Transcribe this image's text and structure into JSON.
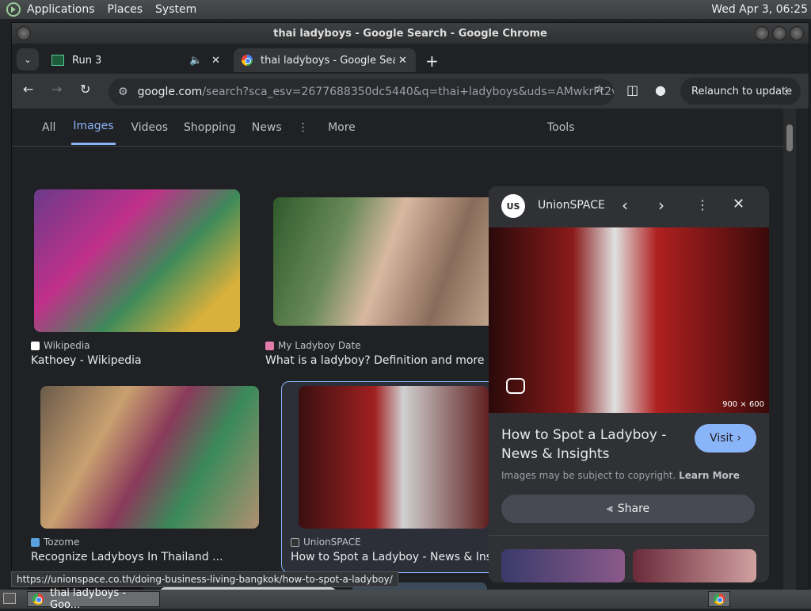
{
  "topbar": {
    "menus": [
      "Applications",
      "Places",
      "System"
    ],
    "clock": "Wed Apr  3, 06:25"
  },
  "window": {
    "title": "thai ladyboys - Google Search - Google Chrome"
  },
  "tabs": [
    {
      "label": "Run 3",
      "audio": "speaker-icon"
    },
    {
      "label": "thai ladyboys - Google Search"
    }
  ],
  "address": {
    "domain": "google.com",
    "path": "/search?sca_esv=2677688350dc5440&q=thai+ladyboys&uds=AMwkrPt2v0f...",
    "relaunch": "Relaunch to update"
  },
  "search_tabs": [
    "All",
    "Images",
    "Videos",
    "Shopping",
    "News",
    "More"
  ],
  "tools": "Tools",
  "results": [
    {
      "source": "Wikipedia",
      "title": "Kathoey - Wikipedia"
    },
    {
      "source": "My Ladyboy Date",
      "title": "What is a ladyboy? Definition and more ..."
    },
    {
      "source": "Tozome",
      "title": "Recognize Ladyboys In Thailand ..."
    },
    {
      "source": "UnionSPACE",
      "title": "How to Spot a Ladyboy - News & Insights"
    }
  ],
  "panel": {
    "source": "UnionSPACE",
    "logo": "US",
    "dims": "900 × 600",
    "title_line1": "How to Spot a Ladyboy -",
    "title_line2": "News & Insights",
    "visit": "Visit",
    "copyright": "Images may be subject to copyright.",
    "learn_more": "Learn More",
    "share": "Share"
  },
  "status_url": "https://unionspace.co.th/doing-business-living-bangkok/how-to-spot-a-ladyboy/",
  "taskbar": {
    "item": "thai ladyboys - Goo..."
  },
  "colors": {
    "accent": "#8ab4f8",
    "bg": "#202124",
    "panel": "#303134"
  }
}
